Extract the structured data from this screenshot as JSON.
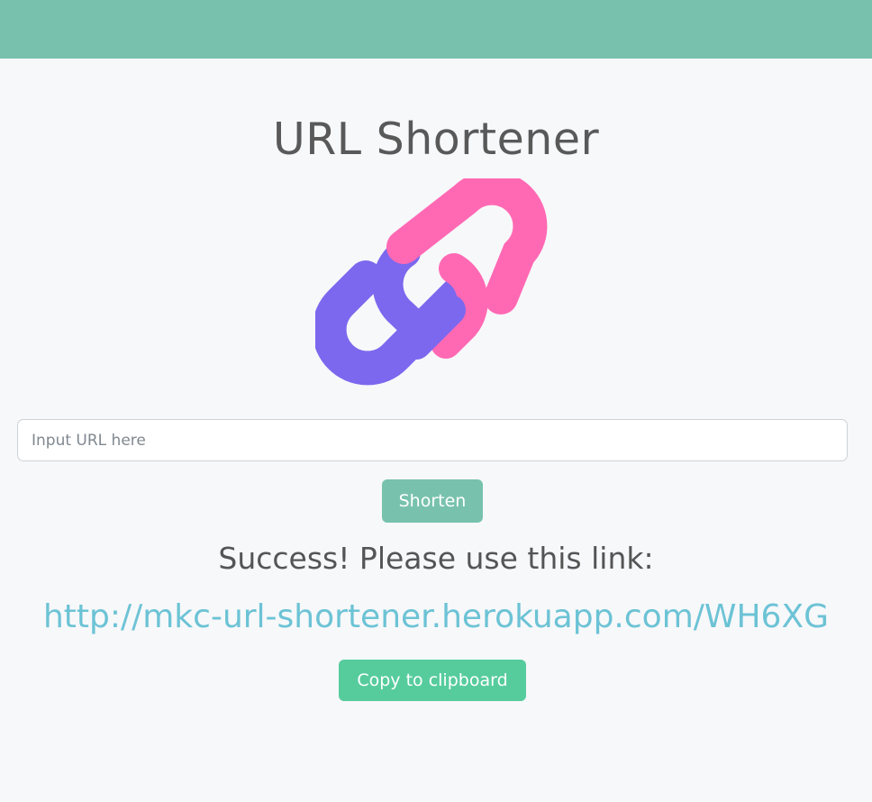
{
  "header": {
    "bar_color": "#78c2ad"
  },
  "main": {
    "title": "URL Shortener",
    "logo": {
      "icon": "link-chain-icon",
      "colors": {
        "primary": "#ff69b4",
        "secondary": "#7b68ee"
      }
    },
    "input": {
      "value": "",
      "placeholder": "Input URL here"
    },
    "shorten_label": "Shorten",
    "success_text": "Success! Please use this link:",
    "short_url": "http://mkc-url-shortener.herokuapp.com/WH6XG",
    "copy_label": "Copy to clipboard"
  },
  "colors": {
    "background": "#f7f8fa",
    "primary": "#78c2ad",
    "success": "#56cc9d",
    "link": "#6cc3d5",
    "text": "#555555"
  }
}
